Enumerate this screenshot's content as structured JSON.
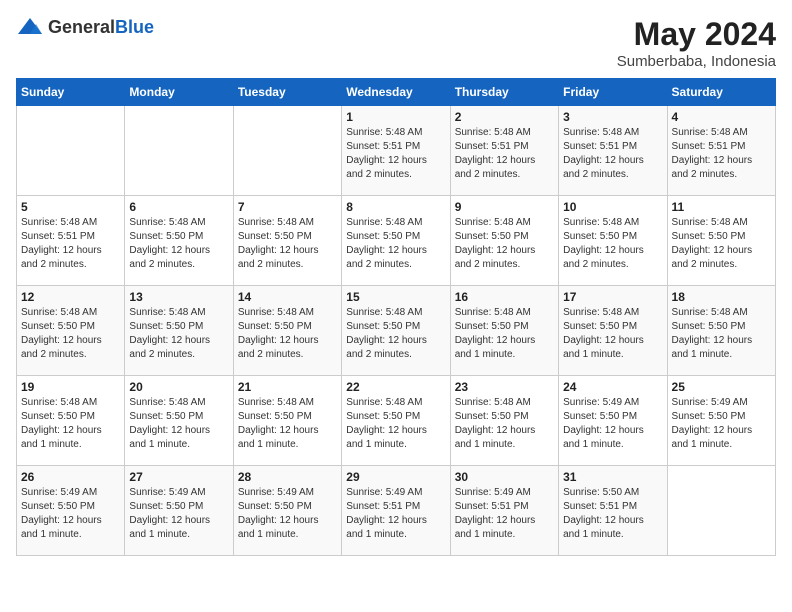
{
  "logo": {
    "general": "General",
    "blue": "Blue"
  },
  "title": "May 2024",
  "location": "Sumberbaba, Indonesia",
  "days_of_week": [
    "Sunday",
    "Monday",
    "Tuesday",
    "Wednesday",
    "Thursday",
    "Friday",
    "Saturday"
  ],
  "weeks": [
    [
      {
        "day": "",
        "info": ""
      },
      {
        "day": "",
        "info": ""
      },
      {
        "day": "",
        "info": ""
      },
      {
        "day": "1",
        "info": "Sunrise: 5:48 AM\nSunset: 5:51 PM\nDaylight: 12 hours and 2 minutes."
      },
      {
        "day": "2",
        "info": "Sunrise: 5:48 AM\nSunset: 5:51 PM\nDaylight: 12 hours and 2 minutes."
      },
      {
        "day": "3",
        "info": "Sunrise: 5:48 AM\nSunset: 5:51 PM\nDaylight: 12 hours and 2 minutes."
      },
      {
        "day": "4",
        "info": "Sunrise: 5:48 AM\nSunset: 5:51 PM\nDaylight: 12 hours and 2 minutes."
      }
    ],
    [
      {
        "day": "5",
        "info": "Sunrise: 5:48 AM\nSunset: 5:51 PM\nDaylight: 12 hours and 2 minutes."
      },
      {
        "day": "6",
        "info": "Sunrise: 5:48 AM\nSunset: 5:50 PM\nDaylight: 12 hours and 2 minutes."
      },
      {
        "day": "7",
        "info": "Sunrise: 5:48 AM\nSunset: 5:50 PM\nDaylight: 12 hours and 2 minutes."
      },
      {
        "day": "8",
        "info": "Sunrise: 5:48 AM\nSunset: 5:50 PM\nDaylight: 12 hours and 2 minutes."
      },
      {
        "day": "9",
        "info": "Sunrise: 5:48 AM\nSunset: 5:50 PM\nDaylight: 12 hours and 2 minutes."
      },
      {
        "day": "10",
        "info": "Sunrise: 5:48 AM\nSunset: 5:50 PM\nDaylight: 12 hours and 2 minutes."
      },
      {
        "day": "11",
        "info": "Sunrise: 5:48 AM\nSunset: 5:50 PM\nDaylight: 12 hours and 2 minutes."
      }
    ],
    [
      {
        "day": "12",
        "info": "Sunrise: 5:48 AM\nSunset: 5:50 PM\nDaylight: 12 hours and 2 minutes."
      },
      {
        "day": "13",
        "info": "Sunrise: 5:48 AM\nSunset: 5:50 PM\nDaylight: 12 hours and 2 minutes."
      },
      {
        "day": "14",
        "info": "Sunrise: 5:48 AM\nSunset: 5:50 PM\nDaylight: 12 hours and 2 minutes."
      },
      {
        "day": "15",
        "info": "Sunrise: 5:48 AM\nSunset: 5:50 PM\nDaylight: 12 hours and 2 minutes."
      },
      {
        "day": "16",
        "info": "Sunrise: 5:48 AM\nSunset: 5:50 PM\nDaylight: 12 hours and 1 minute."
      },
      {
        "day": "17",
        "info": "Sunrise: 5:48 AM\nSunset: 5:50 PM\nDaylight: 12 hours and 1 minute."
      },
      {
        "day": "18",
        "info": "Sunrise: 5:48 AM\nSunset: 5:50 PM\nDaylight: 12 hours and 1 minute."
      }
    ],
    [
      {
        "day": "19",
        "info": "Sunrise: 5:48 AM\nSunset: 5:50 PM\nDaylight: 12 hours and 1 minute."
      },
      {
        "day": "20",
        "info": "Sunrise: 5:48 AM\nSunset: 5:50 PM\nDaylight: 12 hours and 1 minute."
      },
      {
        "day": "21",
        "info": "Sunrise: 5:48 AM\nSunset: 5:50 PM\nDaylight: 12 hours and 1 minute."
      },
      {
        "day": "22",
        "info": "Sunrise: 5:48 AM\nSunset: 5:50 PM\nDaylight: 12 hours and 1 minute."
      },
      {
        "day": "23",
        "info": "Sunrise: 5:48 AM\nSunset: 5:50 PM\nDaylight: 12 hours and 1 minute."
      },
      {
        "day": "24",
        "info": "Sunrise: 5:49 AM\nSunset: 5:50 PM\nDaylight: 12 hours and 1 minute."
      },
      {
        "day": "25",
        "info": "Sunrise: 5:49 AM\nSunset: 5:50 PM\nDaylight: 12 hours and 1 minute."
      }
    ],
    [
      {
        "day": "26",
        "info": "Sunrise: 5:49 AM\nSunset: 5:50 PM\nDaylight: 12 hours and 1 minute."
      },
      {
        "day": "27",
        "info": "Sunrise: 5:49 AM\nSunset: 5:50 PM\nDaylight: 12 hours and 1 minute."
      },
      {
        "day": "28",
        "info": "Sunrise: 5:49 AM\nSunset: 5:50 PM\nDaylight: 12 hours and 1 minute."
      },
      {
        "day": "29",
        "info": "Sunrise: 5:49 AM\nSunset: 5:51 PM\nDaylight: 12 hours and 1 minute."
      },
      {
        "day": "30",
        "info": "Sunrise: 5:49 AM\nSunset: 5:51 PM\nDaylight: 12 hours and 1 minute."
      },
      {
        "day": "31",
        "info": "Sunrise: 5:50 AM\nSunset: 5:51 PM\nDaylight: 12 hours and 1 minute."
      },
      {
        "day": "",
        "info": ""
      }
    ]
  ]
}
